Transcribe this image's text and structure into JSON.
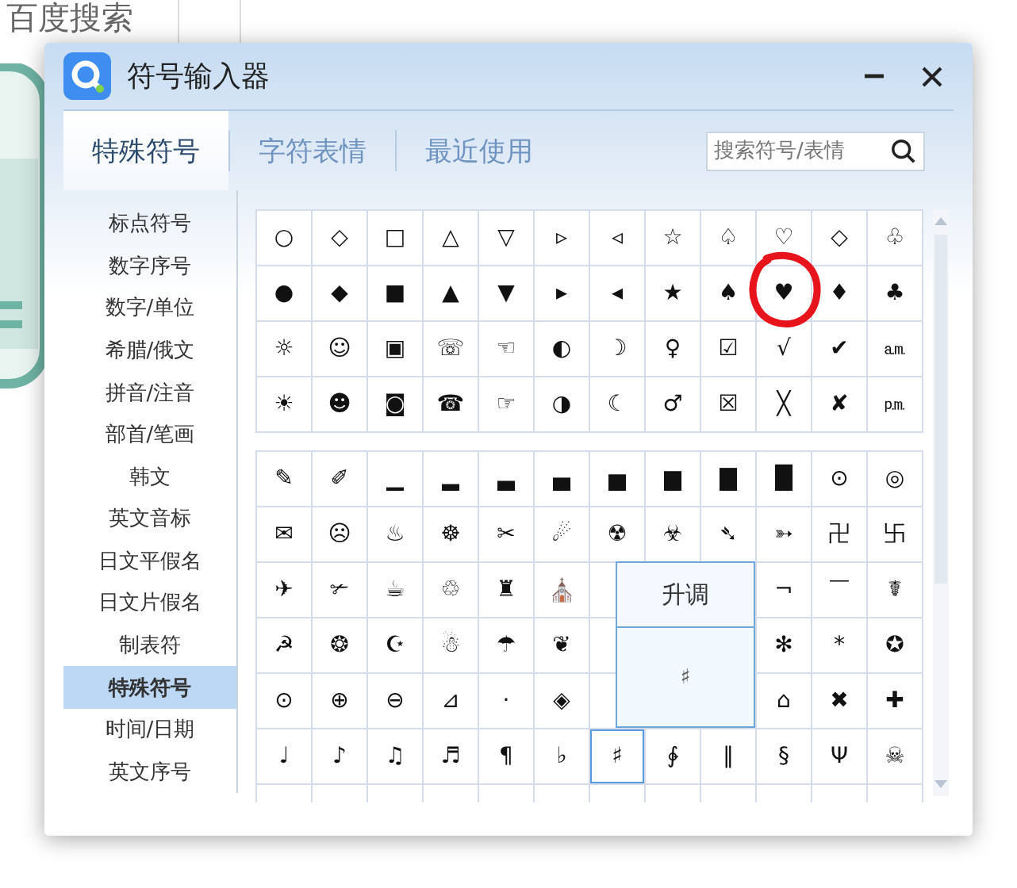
{
  "page": {
    "heading": "百度搜索"
  },
  "window": {
    "title": "符号输入器"
  },
  "tabs": [
    {
      "label": "特殊符号",
      "selected": true
    },
    {
      "label": "字符表情",
      "selected": false
    },
    {
      "label": "最近使用",
      "selected": false
    }
  ],
  "search": {
    "placeholder": "搜索符号/表情"
  },
  "sidebar": {
    "items": [
      {
        "label": "标点符号",
        "selected": false
      },
      {
        "label": "数字序号",
        "selected": false
      },
      {
        "label": "数字/单位",
        "selected": false
      },
      {
        "label": "希腊/俄文",
        "selected": false
      },
      {
        "label": "拼音/注音",
        "selected": false
      },
      {
        "label": "部首/笔画",
        "selected": false
      },
      {
        "label": "韩文",
        "selected": false
      },
      {
        "label": "英文音标",
        "selected": false
      },
      {
        "label": "日文平假名",
        "selected": false
      },
      {
        "label": "日文片假名",
        "selected": false
      },
      {
        "label": "制表符",
        "selected": false
      },
      {
        "label": "特殊符号",
        "selected": true
      },
      {
        "label": "时间/日期",
        "selected": false
      },
      {
        "label": "英文序号",
        "selected": false
      }
    ]
  },
  "grids": [
    {
      "rows": [
        [
          {
            "symbol": "○",
            "selected": false,
            "circled": false
          },
          {
            "symbol": "◇",
            "selected": false,
            "circled": false
          },
          {
            "symbol": "□",
            "selected": false,
            "circled": false
          },
          {
            "symbol": "△",
            "selected": false,
            "circled": false
          },
          {
            "symbol": "▽",
            "selected": false,
            "circled": false
          },
          {
            "symbol": "▹",
            "selected": false,
            "circled": false
          },
          {
            "symbol": "◃",
            "selected": false,
            "circled": false
          },
          {
            "symbol": "☆",
            "selected": false,
            "circled": false
          },
          {
            "symbol": "♤",
            "selected": false,
            "circled": false
          },
          {
            "symbol": "♡",
            "selected": false,
            "circled": false
          },
          {
            "symbol": "◇",
            "selected": false,
            "circled": false
          },
          {
            "symbol": "♧",
            "selected": false,
            "circled": false
          }
        ],
        [
          {
            "symbol": "●",
            "selected": false,
            "circled": false
          },
          {
            "symbol": "◆",
            "selected": false,
            "circled": false
          },
          {
            "symbol": "■",
            "selected": false,
            "circled": false
          },
          {
            "symbol": "▲",
            "selected": false,
            "circled": false
          },
          {
            "symbol": "▼",
            "selected": false,
            "circled": false
          },
          {
            "symbol": "▸",
            "selected": false,
            "circled": false
          },
          {
            "symbol": "◂",
            "selected": false,
            "circled": false
          },
          {
            "symbol": "★",
            "selected": false,
            "circled": false
          },
          {
            "symbol": "♠",
            "selected": false,
            "circled": false
          },
          {
            "symbol": "♥",
            "selected": false,
            "circled": true
          },
          {
            "symbol": "♦",
            "selected": false,
            "circled": false
          },
          {
            "symbol": "♣",
            "selected": false,
            "circled": false
          }
        ],
        [
          {
            "symbol": "☼",
            "selected": false,
            "circled": false
          },
          {
            "symbol": "☺",
            "selected": false,
            "circled": false
          },
          {
            "symbol": "▣",
            "selected": false,
            "circled": false
          },
          {
            "symbol": "☏",
            "selected": false,
            "circled": false
          },
          {
            "symbol": "☜",
            "selected": false,
            "circled": false
          },
          {
            "symbol": "◐",
            "selected": false,
            "circled": false
          },
          {
            "symbol": "☽",
            "selected": false,
            "circled": false
          },
          {
            "symbol": "♀",
            "selected": false,
            "circled": false
          },
          {
            "symbol": "☑",
            "selected": false,
            "circled": false
          },
          {
            "symbol": "√",
            "selected": false,
            "circled": false
          },
          {
            "symbol": "✔",
            "selected": false,
            "circled": false
          },
          {
            "symbol": "㏂",
            "selected": false,
            "circled": false
          }
        ],
        [
          {
            "symbol": "☀",
            "selected": false,
            "circled": false
          },
          {
            "symbol": "☻",
            "selected": false,
            "circled": false
          },
          {
            "symbol": "◙",
            "selected": false,
            "circled": false
          },
          {
            "symbol": "☎",
            "selected": false,
            "circled": false
          },
          {
            "symbol": "☞",
            "selected": false,
            "circled": false
          },
          {
            "symbol": "◑",
            "selected": false,
            "circled": false
          },
          {
            "symbol": "☾",
            "selected": false,
            "circled": false
          },
          {
            "symbol": "♂",
            "selected": false,
            "circled": false
          },
          {
            "symbol": "☒",
            "selected": false,
            "circled": false
          },
          {
            "symbol": "╳",
            "selected": false,
            "circled": false
          },
          {
            "symbol": "✘",
            "selected": false,
            "circled": false
          },
          {
            "symbol": "㏘",
            "selected": false,
            "circled": false
          }
        ]
      ]
    },
    {
      "rows": [
        [
          {
            "symbol": "✎",
            "selected": false,
            "circled": false
          },
          {
            "symbol": "✐",
            "selected": false,
            "circled": false
          },
          {
            "symbol": "▁",
            "selected": false,
            "circled": false
          },
          {
            "symbol": "▂",
            "selected": false,
            "circled": false
          },
          {
            "symbol": "▃",
            "selected": false,
            "circled": false
          },
          {
            "symbol": "▄",
            "selected": false,
            "circled": false
          },
          {
            "symbol": "▅",
            "selected": false,
            "circled": false
          },
          {
            "symbol": "▆",
            "selected": false,
            "circled": false
          },
          {
            "symbol": "▇",
            "selected": false,
            "circled": false
          },
          {
            "symbol": "█",
            "selected": false,
            "circled": false
          },
          {
            "symbol": "⊙",
            "selected": false,
            "circled": false
          },
          {
            "symbol": "◎",
            "selected": false,
            "circled": false
          }
        ],
        [
          {
            "symbol": "✉",
            "selected": false,
            "circled": false
          },
          {
            "symbol": "☹",
            "selected": false,
            "circled": false
          },
          {
            "symbol": "♨",
            "selected": false,
            "circled": false
          },
          {
            "symbol": "☸",
            "selected": false,
            "circled": false
          },
          {
            "symbol": "✂",
            "selected": false,
            "circled": false
          },
          {
            "symbol": "☄",
            "selected": false,
            "circled": false
          },
          {
            "symbol": "☢",
            "selected": false,
            "circled": false
          },
          {
            "symbol": "☣",
            "selected": false,
            "circled": false
          },
          {
            "symbol": "➴",
            "selected": false,
            "circled": false
          },
          {
            "symbol": "➳",
            "selected": false,
            "circled": false
          },
          {
            "symbol": "卍",
            "selected": false,
            "circled": false
          },
          {
            "symbol": "卐",
            "selected": false,
            "circled": false
          }
        ],
        [
          {
            "symbol": "✈",
            "selected": false,
            "circled": false
          },
          {
            "symbol": "✃",
            "selected": false,
            "circled": false
          },
          {
            "symbol": "☕",
            "selected": false,
            "circled": false
          },
          {
            "symbol": "♲",
            "selected": false,
            "circled": false
          },
          {
            "symbol": "♜",
            "selected": false,
            "circled": false
          },
          {
            "symbol": "⛪",
            "selected": false,
            "circled": false
          },
          null,
          null,
          null,
          {
            "symbol": "¬",
            "selected": false,
            "circled": false
          },
          {
            "symbol": "￣",
            "selected": false,
            "circled": false
          },
          {
            "symbol": "☤",
            "selected": false,
            "circled": false
          }
        ],
        [
          {
            "symbol": "☭",
            "selected": false,
            "circled": false
          },
          {
            "symbol": "❂",
            "selected": false,
            "circled": false
          },
          {
            "symbol": "☪",
            "selected": false,
            "circled": false
          },
          {
            "symbol": "☃",
            "selected": false,
            "circled": false
          },
          {
            "symbol": "☂",
            "selected": false,
            "circled": false
          },
          {
            "symbol": "❦",
            "selected": false,
            "circled": false
          },
          null,
          null,
          null,
          {
            "symbol": "✻",
            "selected": false,
            "circled": false
          },
          {
            "symbol": "*",
            "selected": false,
            "circled": false
          },
          {
            "symbol": "✪",
            "selected": false,
            "circled": false
          }
        ],
        [
          {
            "symbol": "⊙",
            "selected": false,
            "circled": false
          },
          {
            "symbol": "⊕",
            "selected": false,
            "circled": false
          },
          {
            "symbol": "⊖",
            "selected": false,
            "circled": false
          },
          {
            "symbol": "⊿",
            "selected": false,
            "circled": false
          },
          {
            "symbol": "·",
            "selected": false,
            "circled": false
          },
          {
            "symbol": "◈",
            "selected": false,
            "circled": false
          },
          null,
          null,
          null,
          {
            "symbol": "⌂",
            "selected": false,
            "circled": false
          },
          {
            "symbol": "✖",
            "selected": false,
            "circled": false
          },
          {
            "symbol": "✚",
            "selected": false,
            "circled": false
          }
        ],
        [
          {
            "symbol": "♩",
            "selected": false,
            "circled": false
          },
          {
            "symbol": "♪",
            "selected": false,
            "circled": false
          },
          {
            "symbol": "♫",
            "selected": false,
            "circled": false
          },
          {
            "symbol": "♬",
            "selected": false,
            "circled": false
          },
          {
            "symbol": "¶",
            "selected": false,
            "circled": false
          },
          {
            "symbol": "♭",
            "selected": false,
            "circled": false
          },
          {
            "symbol": "♯",
            "selected": true,
            "circled": false
          },
          {
            "symbol": "∲",
            "selected": false,
            "circled": false
          },
          {
            "symbol": "‖",
            "selected": false,
            "circled": false
          },
          {
            "symbol": "§",
            "selected": false,
            "circled": false
          },
          {
            "symbol": "Ψ",
            "selected": false,
            "circled": false
          },
          {
            "symbol": "☠",
            "selected": false,
            "circled": false
          }
        ]
      ]
    }
  ],
  "tooltip": {
    "label": "升调",
    "preview": "♯"
  }
}
